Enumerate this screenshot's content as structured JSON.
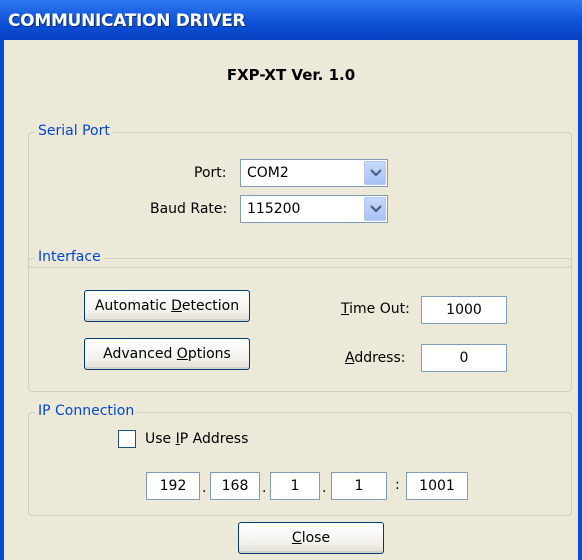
{
  "window": {
    "title": "COMMUNICATION DRIVER"
  },
  "heading": "FXP-XT Ver. 1.0",
  "serial_port": {
    "legend": "Serial Port",
    "port_label": "Port:",
    "port_value": "COM2",
    "baud_label": "Baud Rate:",
    "baud_value": "115200"
  },
  "interface": {
    "legend": "Interface",
    "auto_detect_prefix": "Automatic ",
    "auto_detect_mnemonic": "D",
    "auto_detect_suffix": "etection",
    "advanced_prefix": "Advanced ",
    "advanced_mnemonic": "O",
    "advanced_suffix": "ptions",
    "timeout_mnemonic": "T",
    "timeout_suffix": "ime Out:",
    "timeout_value": "1000",
    "address_mnemonic": "A",
    "address_suffix": "ddress:",
    "address_value": "0"
  },
  "ip_connection": {
    "legend": "IP Connection",
    "use_ip_prefix": "Use ",
    "use_ip_mnemonic": "I",
    "use_ip_suffix": "P Address",
    "use_ip_checked": false,
    "octet1": "192",
    "octet2": "168",
    "octet3": "1",
    "octet4": "1",
    "port": "1001",
    "dot": ".",
    "colon": ":"
  },
  "close": {
    "mnemonic": "C",
    "suffix": "lose"
  },
  "icons": {
    "dropdown": "chevron-down-icon"
  },
  "colors": {
    "title_bar": "#0a4bd0",
    "dialog_bg": "#ece9d8",
    "legend_text": "#0046d5"
  }
}
